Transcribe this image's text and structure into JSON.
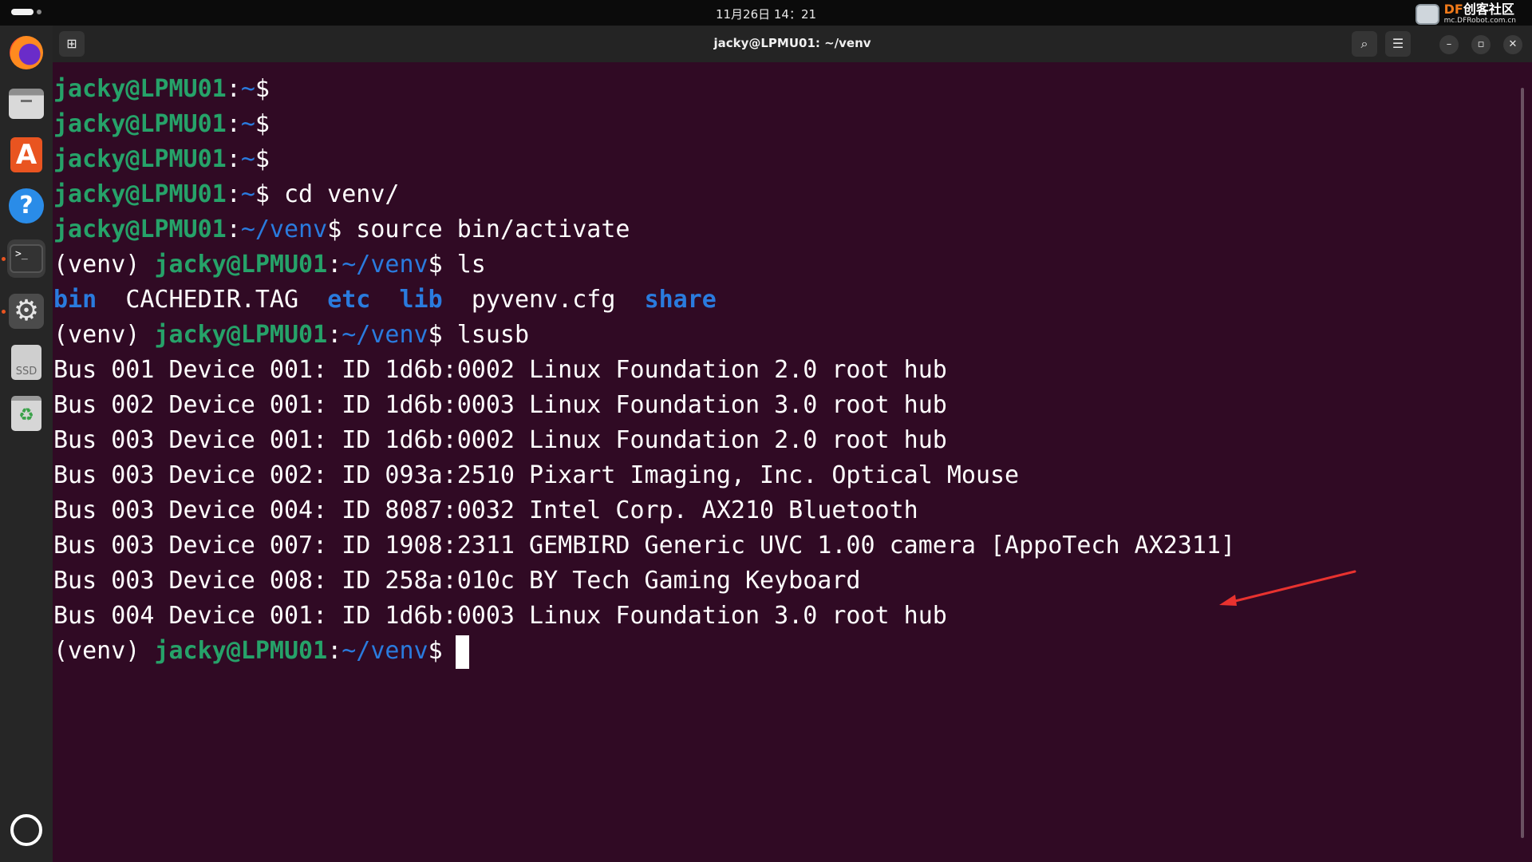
{
  "topbar": {
    "clock": "11月26日  14：21",
    "watermark_brand_df": "DF",
    "watermark_brand_cn": "创客社区",
    "watermark_sub": "mc.DFRobot.com.cn"
  },
  "dock": {
    "items": [
      "firefox-icon",
      "files-icon",
      "app-center-icon",
      "help-icon",
      "terminal-icon",
      "settings-icon",
      "ssd-drive-icon",
      "trash-icon",
      "show-apps-icon"
    ],
    "ssd_label": "SSD",
    "help_glyph": "?",
    "store_glyph": "A",
    "terminal_glyph": ">_",
    "settings_glyph": "⚙",
    "trash_glyph": "♻"
  },
  "window": {
    "title": "jacky@LPMU01: ~/venv",
    "new_tab_glyph": "⊞",
    "search_glyph": "⌕",
    "menu_glyph": "☰",
    "minimize_glyph": "–",
    "maximize_glyph": "▫",
    "close_glyph": "✕"
  },
  "terminal": {
    "user": "jacky@LPMU01",
    "venv_prefix": "(venv) ",
    "lines": [
      {
        "path": "~",
        "cmd": ""
      },
      {
        "path": "~",
        "cmd": ""
      },
      {
        "path": "~",
        "cmd": ""
      },
      {
        "path": "~",
        "cmd": " cd venv/"
      },
      {
        "path": "~/venv",
        "cmd": " source bin/activate"
      },
      {
        "path": "~/venv",
        "cmd": " ls"
      },
      {
        "path": "~/venv",
        "cmd": " lsusb"
      },
      {
        "path": "~/venv",
        "cmd": " "
      }
    ],
    "ls_output": {
      "bin": "bin",
      "cachedir": "CACHEDIR.TAG",
      "etc": "etc",
      "lib": "lib",
      "pyvenv": "pyvenv.cfg",
      "share": "share"
    },
    "lsusb_output": [
      "Bus 001 Device 001: ID 1d6b:0002 Linux Foundation 2.0 root hub",
      "Bus 002 Device 001: ID 1d6b:0003 Linux Foundation 3.0 root hub",
      "Bus 003 Device 001: ID 1d6b:0002 Linux Foundation 2.0 root hub",
      "Bus 003 Device 002: ID 093a:2510 Pixart Imaging, Inc. Optical Mouse",
      "Bus 003 Device 004: ID 8087:0032 Intel Corp. AX210 Bluetooth",
      "Bus 003 Device 007: ID 1908:2311 GEMBIRD Generic UVC 1.00 camera [AppoTech AX2311]",
      "Bus 003 Device 008: ID 258a:010c BY Tech Gaming Keyboard",
      "Bus 004 Device 001: ID 1d6b:0003 Linux Foundation 3.0 root hub"
    ]
  },
  "colors": {
    "terminal_bg": "#300a24",
    "prompt_user": "#26a269",
    "prompt_path": "#2a7bde",
    "annotation_arrow": "#e8322f"
  }
}
